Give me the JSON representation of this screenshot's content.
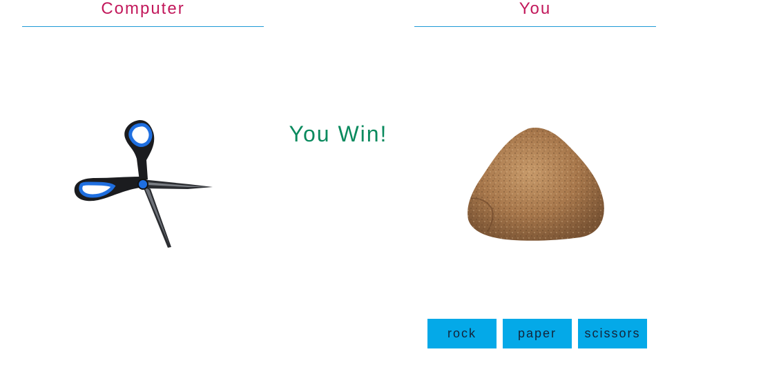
{
  "computer": {
    "title": "Computer",
    "choice_icon": "scissors-icon"
  },
  "player": {
    "title": "You",
    "choice_icon": "rock-icon"
  },
  "result": {
    "text": "You Win!",
    "color": "#0a8a5e"
  },
  "controls": {
    "rock_label": "rock",
    "paper_label": "paper",
    "scissors_label": "scissors",
    "button_color": "#04a9e8"
  },
  "theme": {
    "title_color": "#c2185b",
    "divider_color": "#1e9ad6"
  }
}
